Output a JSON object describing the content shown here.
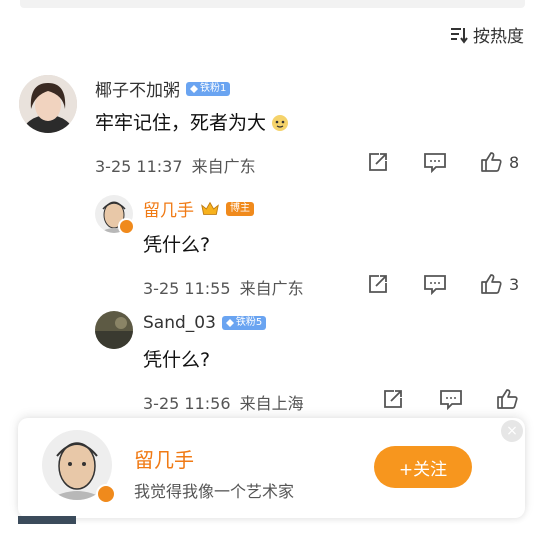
{
  "sort": {
    "label": "按热度"
  },
  "comment": {
    "user": "椰子不加粥",
    "fan_badge": "铁粉1",
    "text": "牢牢记住，死者为大",
    "time": "3-25 11:37",
    "location": "来自广东",
    "likes": "8"
  },
  "replies": [
    {
      "user": "留几手",
      "role_badge": "博主",
      "text": "凭什么?",
      "time": "3-25 11:55",
      "location": "来自广东",
      "likes": "3"
    },
    {
      "user": "Sand_03",
      "fan_badge": "铁粉5",
      "text": "凭什么?",
      "time": "3-25 11:56",
      "location": "来自上海",
      "likes": ""
    }
  ],
  "card": {
    "name": "留几手",
    "subtitle": "我觉得我像一个艺术家",
    "follow_label": "+关注",
    "close_label": "×"
  },
  "colors": {
    "accent": "#f07a14",
    "follow_bg": "#f7961e",
    "fan_badge": "#6aa4f1"
  },
  "icons": [
    "sort-icon",
    "share-icon",
    "comment-icon",
    "like-icon",
    "vip-badge-icon",
    "crown-icon",
    "emoji-icon",
    "close-icon"
  ]
}
